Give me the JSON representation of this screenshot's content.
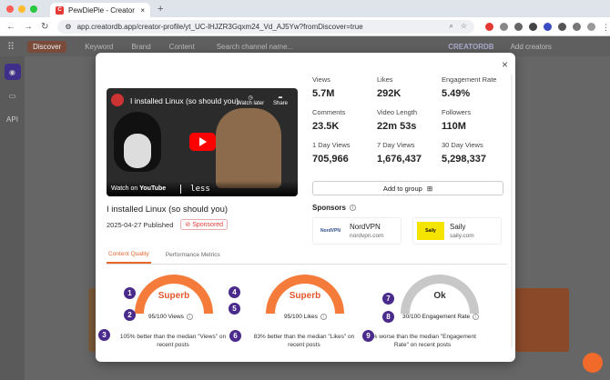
{
  "browser": {
    "tab_title": "PewDiePie - Creator profile -",
    "favicon_letter": "C",
    "new_tab": "+",
    "url": "app.creatordb.app/creator-profile/yt_UC-lHJZR3Gqxm24_Vd_AJ5Yw?fromDiscover=true"
  },
  "app": {
    "nav": [
      "Discover",
      "Keyword",
      "Brand",
      "Content"
    ],
    "search_placeholder": "Search channel name...",
    "brand": "CREATORDB",
    "add_creators": "Add creators",
    "sidebar_api": "API"
  },
  "modal": {
    "close": "×",
    "video": {
      "title_overlay": "I installed Linux (so should you)",
      "watch_later": "Watch later",
      "share": "Share",
      "watch_on": "Watch on",
      "youtube": "YouTube",
      "less": "less"
    },
    "title": "I installed Linux (so should you)",
    "published": "2025-04-27 Published",
    "sponsored": "Sponsored",
    "stats": [
      {
        "label": "Views",
        "value": "5.7M"
      },
      {
        "label": "Likes",
        "value": "292K"
      },
      {
        "label": "Engagement Rate",
        "value": "5.49%"
      },
      {
        "label": "Comments",
        "value": "23.5K"
      },
      {
        "label": "Video Length",
        "value": "22m 53s"
      },
      {
        "label": "Followers",
        "value": "110M"
      },
      {
        "label": "1 Day Views",
        "value": "705,966"
      },
      {
        "label": "7 Day Views",
        "value": "1,676,437"
      },
      {
        "label": "30 Day Views",
        "value": "5,298,337"
      }
    ],
    "add_to_group": "Add to group",
    "sponsors_heading": "Sponsors",
    "sponsors": [
      {
        "name": "NordVPN",
        "domain": "nordvpn.com",
        "logo_text": "NordVPN"
      },
      {
        "name": "Saily",
        "domain": "saily.com",
        "logo_text": "Saily"
      }
    ],
    "tabs": [
      "Content Quality",
      "Performance Metrics"
    ],
    "gauges": [
      {
        "grade": "Superb",
        "score": "95/100 Views",
        "desc": "105% better than the median \"Views\" on recent posts",
        "color": "#f47b3a",
        "level": 0.95
      },
      {
        "grade": "Superb",
        "score": "95/100 Likes",
        "desc": "83% better than the median \"Likes\" on recent posts",
        "color": "#f47b3a",
        "level": 0.95
      },
      {
        "grade": "Ok",
        "score": "30/100 Engagement Rate",
        "desc": "8% worse than the median \"Engagement Rate\" on recent posts",
        "color": "#c8c8c8",
        "level": 0.3
      }
    ],
    "markers": [
      "1",
      "2",
      "3",
      "4",
      "5",
      "6",
      "7",
      "8",
      "9"
    ]
  }
}
